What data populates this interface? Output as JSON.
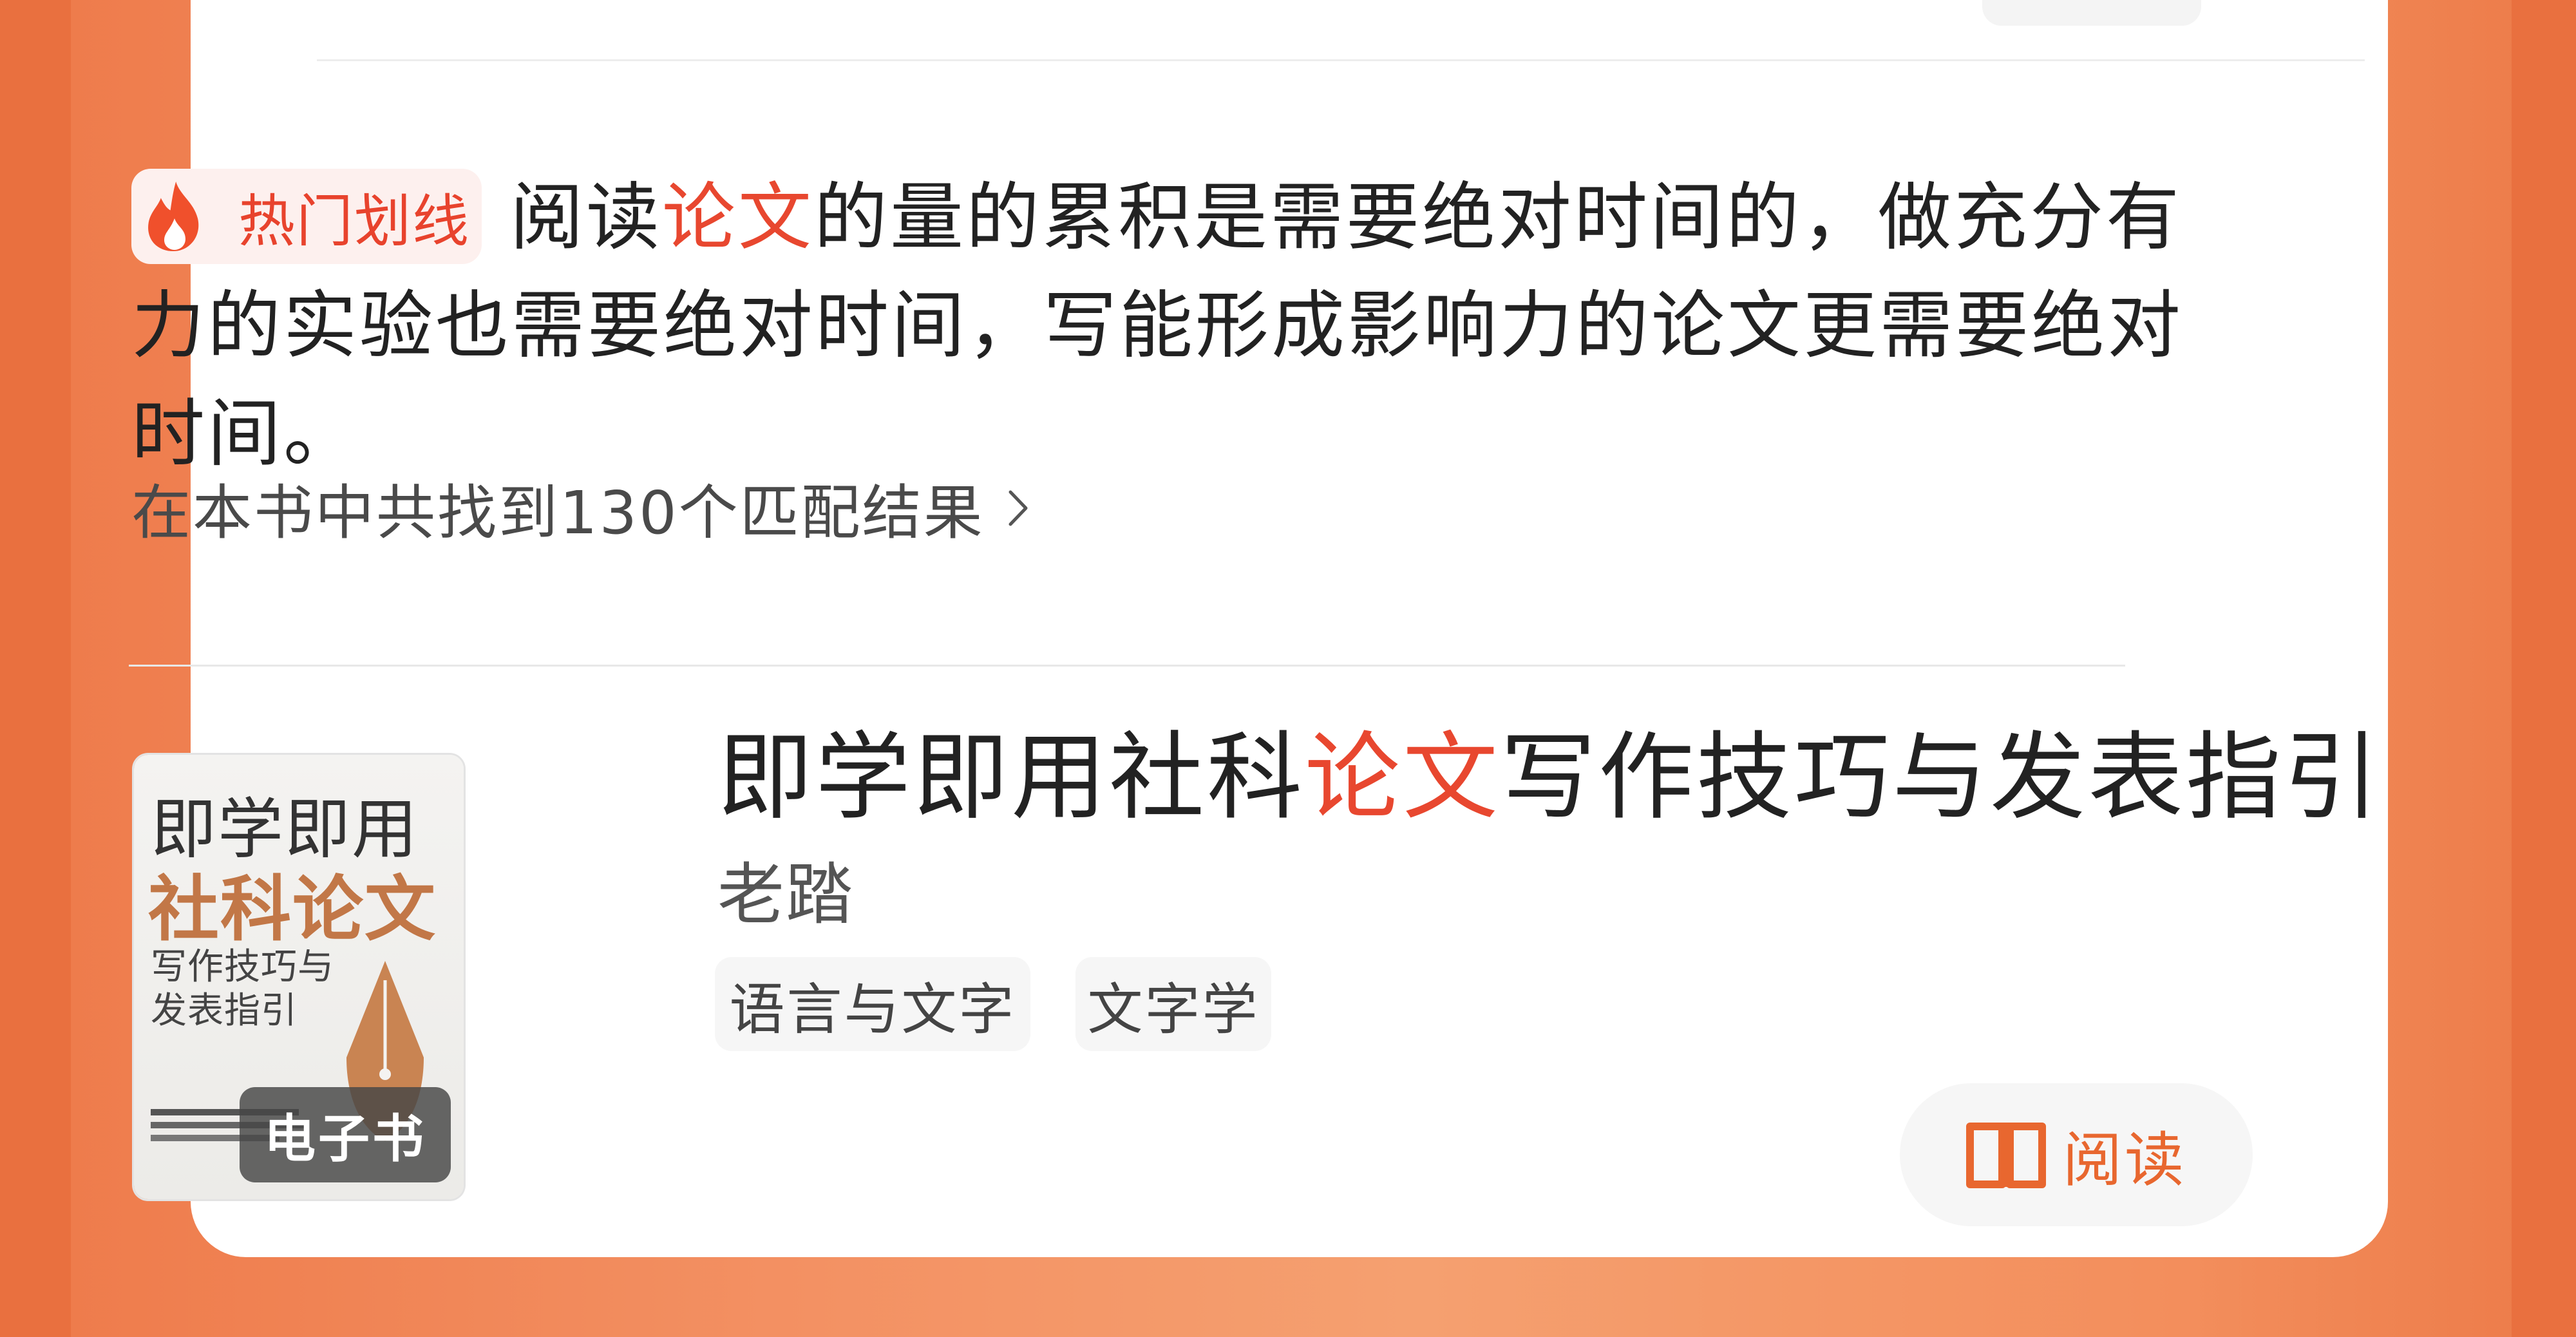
{
  "highlight": {
    "badge_label": "热门划线",
    "quote_part1": "阅读",
    "quote_kw1": "论文",
    "quote_part2": "的量的累积是需要绝对时间的，做充分有力的实验也需要绝对时间，写能形成影响力的论文更需要绝对时间。"
  },
  "match_link": {
    "label": "在本书中共找到130个匹配结果"
  },
  "book": {
    "title_part1": "即学即用社科",
    "title_kw": "论文",
    "title_part2": "写作技巧与发表指引",
    "author": "老踏",
    "tags": [
      "语言与文字",
      "文字学"
    ],
    "read_label": "阅读",
    "cover": {
      "line1": "即学即用",
      "line2": "社科论文",
      "line3": "写作技巧与",
      "line4": "发表指引",
      "badge": "电子书"
    }
  },
  "colors": {
    "accent": "#e8472f",
    "read_accent": "#e8672f",
    "background": "#f39062"
  },
  "icons": {
    "hot": "fire-icon",
    "more": "chevron-right-icon",
    "read": "open-book-icon"
  }
}
